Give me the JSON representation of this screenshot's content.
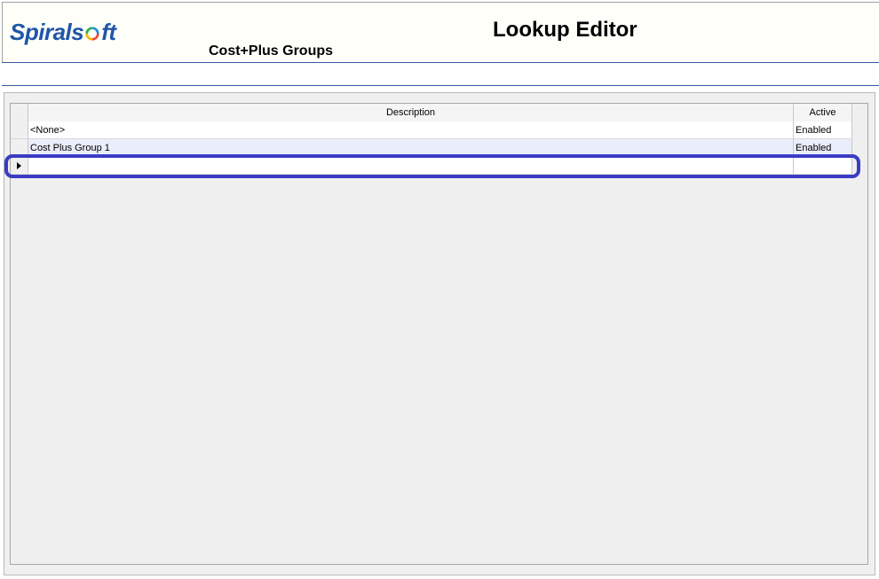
{
  "header": {
    "logo_text_a": "Spirals",
    "logo_text_b": "ft",
    "title": "Lookup Editor",
    "subtitle": "Cost+Plus Groups"
  },
  "grid": {
    "columns": {
      "description": "Description",
      "active": "Active"
    },
    "rows": [
      {
        "description": "<None>",
        "active": "Enabled"
      },
      {
        "description": "Cost Plus Group 1",
        "active": "Enabled"
      },
      {
        "description": "",
        "active": ""
      }
    ]
  },
  "colors": {
    "brand": "#1f56a8",
    "highlight": "#3b3cc4",
    "alt_row": "#eaeefa"
  },
  "icons": {
    "current_row": "row-pointer-icon",
    "logo_o": "spiral-o-icon"
  }
}
